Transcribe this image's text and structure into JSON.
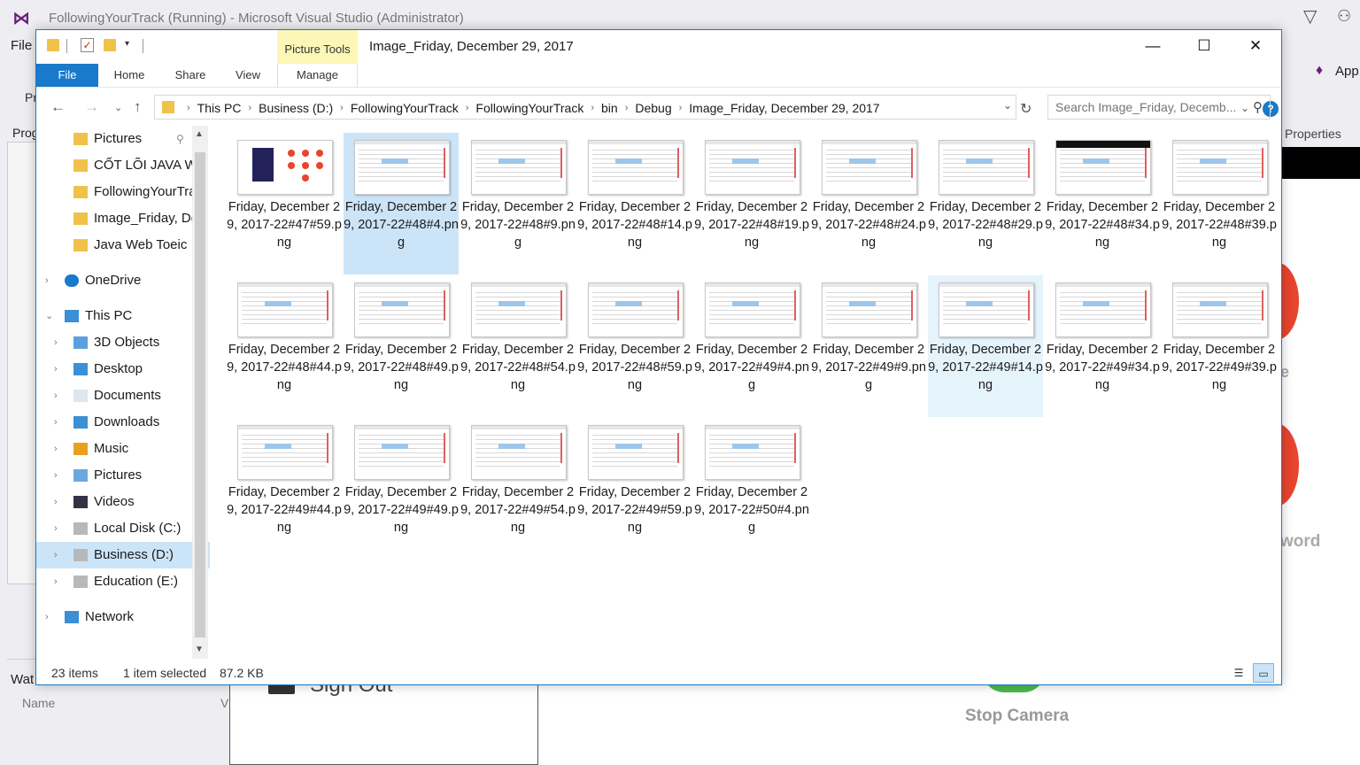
{
  "vs": {
    "title": "FollowingYourTrack (Running) - Microsoft Visual Studio  (Administrator)",
    "menu_file": "File",
    "pr": "Pr",
    "prog": "Prog",
    "app": "App",
    "properties": "Properties",
    "watch": "Wat",
    "name_col": "Name",
    "v_col": "V",
    "sign_out": "Sign Out",
    "stop_camera": "Stop Camera",
    "word": "word",
    "e": "e"
  },
  "explorer": {
    "title": "Image_Friday, December 29, 2017",
    "picture_tools": "Picture Tools",
    "tabs": {
      "file": "File",
      "home": "Home",
      "share": "Share",
      "view": "View",
      "manage": "Manage"
    },
    "breadcrumbs": [
      "This PC",
      "Business (D:)",
      "FollowingYourTrack",
      "FollowingYourTrack",
      "bin",
      "Debug",
      "Image_Friday, December 29, 2017"
    ],
    "search_placeholder": "Search Image_Friday, Decemb...",
    "nav": {
      "quick": [
        "Pictures",
        "CỐT LÕI JAVA W",
        "FollowingYourTra",
        "Image_Friday, De",
        "Java Web Toeic"
      ],
      "onedrive": "OneDrive",
      "this_pc": "This PC",
      "pc_items": [
        "3D Objects",
        "Desktop",
        "Documents",
        "Downloads",
        "Music",
        "Pictures",
        "Videos",
        "Local Disk (C:)",
        "Business (D:)",
        "Education (E:)"
      ],
      "network": "Network"
    },
    "files": [
      "Friday, December 29, 2017-22#47#59.png",
      "Friday, December 29, 2017-22#48#4.png",
      "Friday, December 29, 2017-22#48#9.png",
      "Friday, December 29, 2017-22#48#14.png",
      "Friday, December 29, 2017-22#48#19.png",
      "Friday, December 29, 2017-22#48#24.png",
      "Friday, December 29, 2017-22#48#29.png",
      "Friday, December 29, 2017-22#48#34.png",
      "Friday, December 29, 2017-22#48#39.png",
      "Friday, December 29, 2017-22#48#44.png",
      "Friday, December 29, 2017-22#48#49.png",
      "Friday, December 29, 2017-22#48#54.png",
      "Friday, December 29, 2017-22#48#59.png",
      "Friday, December 29, 2017-22#49#4.png",
      "Friday, December 29, 2017-22#49#9.png",
      "Friday, December 29, 2017-22#49#14.png",
      "Friday, December 29, 2017-22#49#34.png",
      "Friday, December 29, 2017-22#49#39.png",
      "Friday, December 29, 2017-22#49#44.png",
      "Friday, December 29, 2017-22#49#49.png",
      "Friday, December 29, 2017-22#49#54.png",
      "Friday, December 29, 2017-22#49#59.png",
      "Friday, December 29, 2017-22#50#4.png"
    ],
    "status": {
      "count": "23 items",
      "selected": "1 item selected",
      "size": "87.2 KB"
    },
    "accent": "#1979ca",
    "selection": "#cce4f7"
  }
}
